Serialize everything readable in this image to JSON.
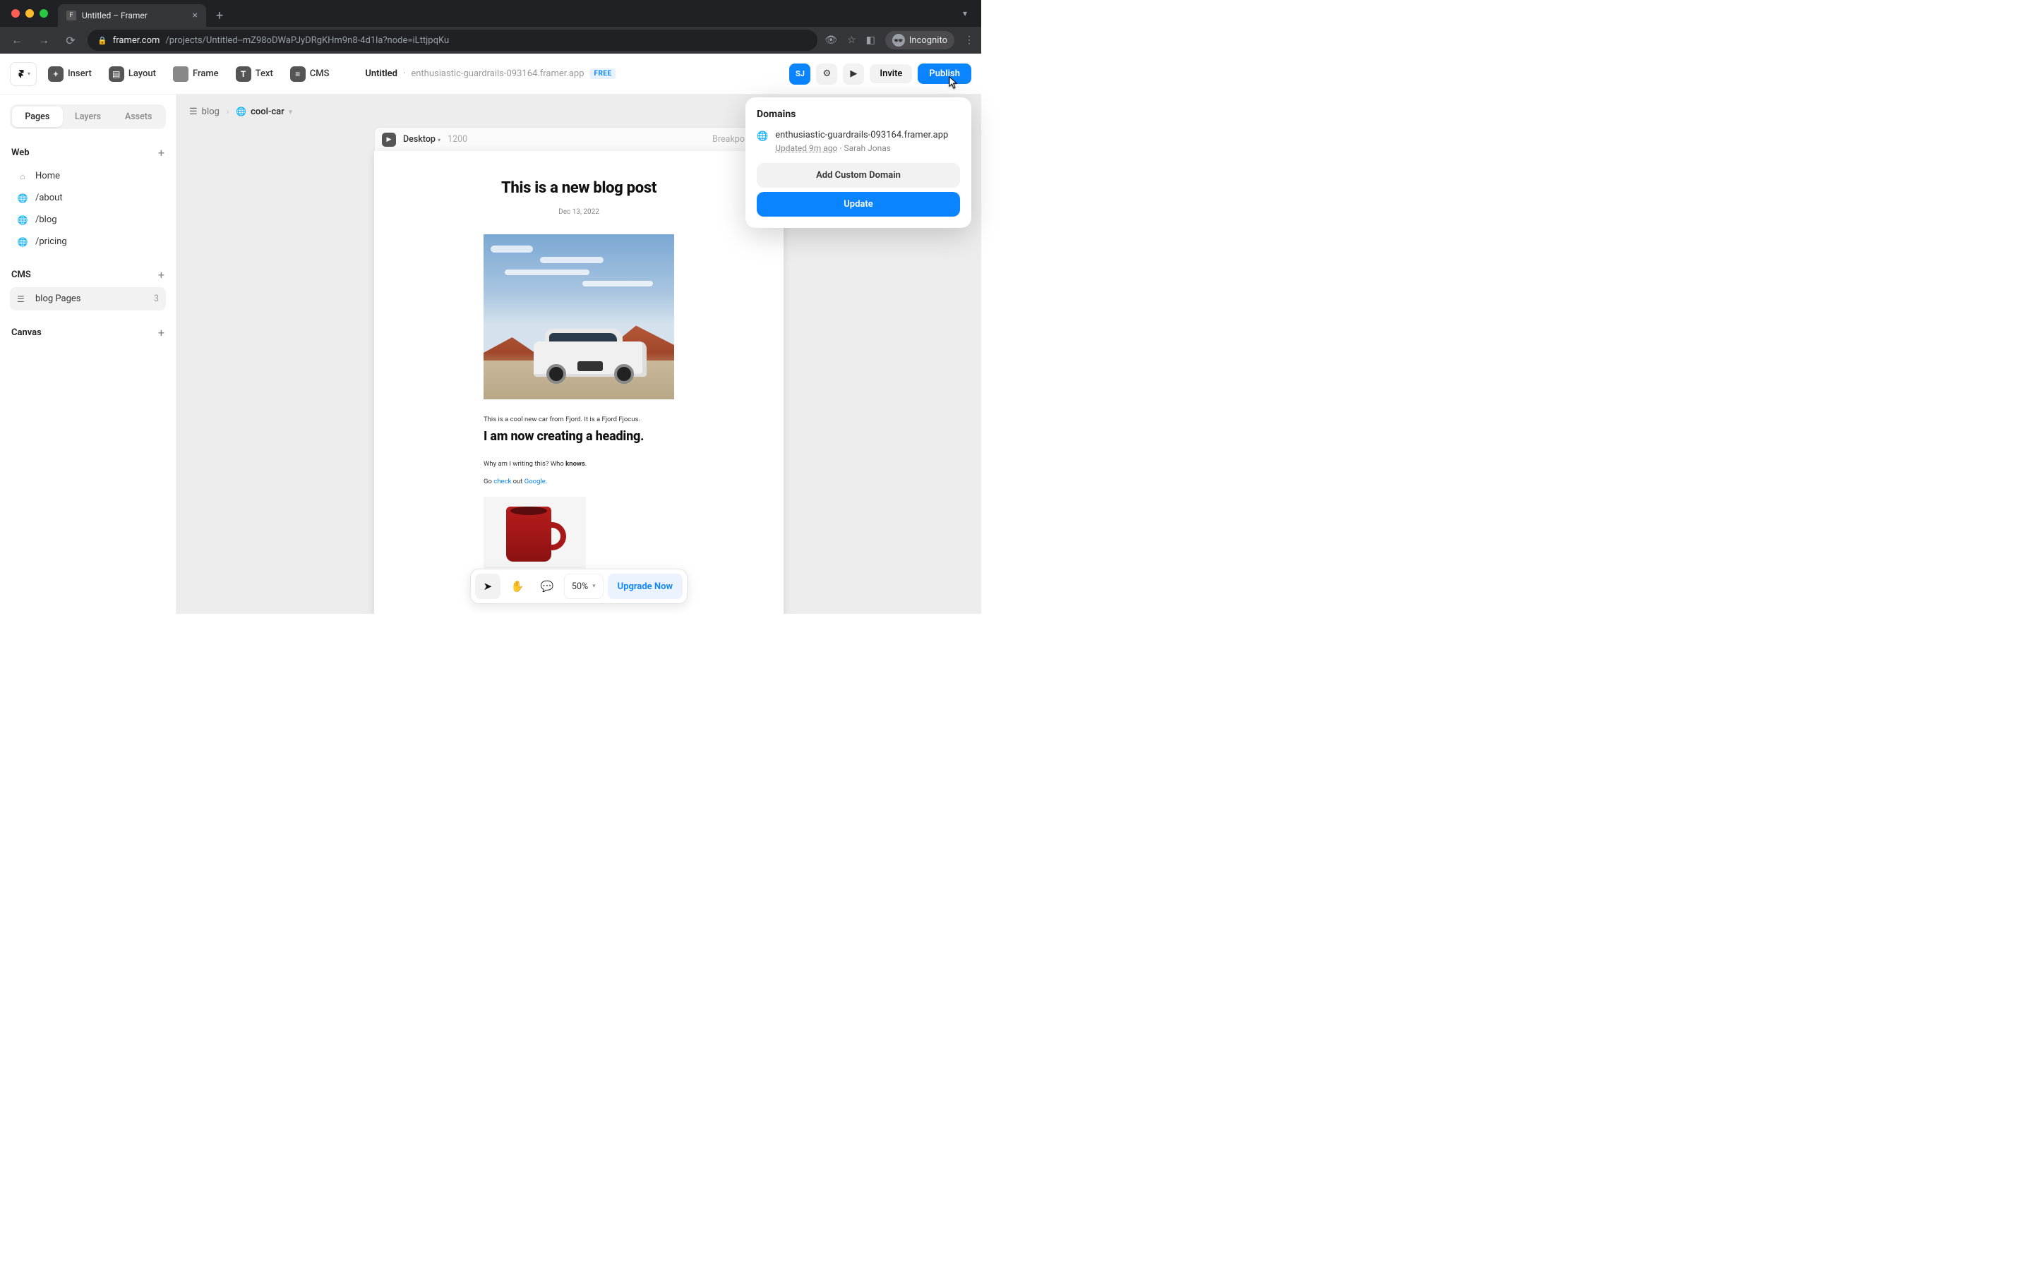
{
  "browser": {
    "tab_title": "Untitled – Framer",
    "url_host": "framer.com",
    "url_path": "/projects/Untitled--mZ98oDWaPJyDRgKHm9n8-4d1la?node=iLttjpqKu",
    "incognito_label": "Incognito"
  },
  "toolbar": {
    "insert": "Insert",
    "layout": "Layout",
    "frame": "Frame",
    "text": "Text",
    "cms": "CMS",
    "project_name": "Untitled",
    "project_domain": "enthusiastic-guardrails-093164.framer.app",
    "plan_badge": "FREE",
    "avatar_initials": "SJ",
    "invite": "Invite",
    "publish": "Publish"
  },
  "sidebar": {
    "tabs": {
      "pages": "Pages",
      "layers": "Layers",
      "assets": "Assets"
    },
    "web_section": "Web",
    "pages": [
      {
        "label": "Home",
        "icon": "home"
      },
      {
        "label": "/about",
        "icon": "globe"
      },
      {
        "label": "/blog",
        "icon": "globe"
      },
      {
        "label": "/pricing",
        "icon": "globe"
      }
    ],
    "cms_section": "CMS",
    "cms_items": [
      {
        "label": "blog Pages",
        "count": "3"
      }
    ],
    "canvas_section": "Canvas"
  },
  "breadcrumb": {
    "root_icon": "stack",
    "root": "blog",
    "current": "cool-car"
  },
  "frame_header": {
    "device": "Desktop",
    "width": "1200",
    "breakpoint_label": "Breakpoint"
  },
  "page_content": {
    "title": "This is a new blog post",
    "date": "Dec 13, 2022",
    "caption": "This is a cool new car from Fjord. It is a Fjord Fjocus.",
    "heading": "I am now creating a heading.",
    "para2_a": "Why am I writing this? Who ",
    "para2_b": "knows",
    "para2_c": ".",
    "para3_a": "Go ",
    "para3_link1": "check",
    "para3_b": " out ",
    "para3_link2": "Google",
    "para3_c": "."
  },
  "bottom_bar": {
    "zoom": "50%",
    "upgrade": "Upgrade Now"
  },
  "popover": {
    "title": "Domains",
    "domain": "enthusiastic-guardrails-093164.framer.app",
    "updated": "Updated 9m ago",
    "author": "Sarah Jonas",
    "add_custom": "Add Custom Domain",
    "update": "Update"
  }
}
